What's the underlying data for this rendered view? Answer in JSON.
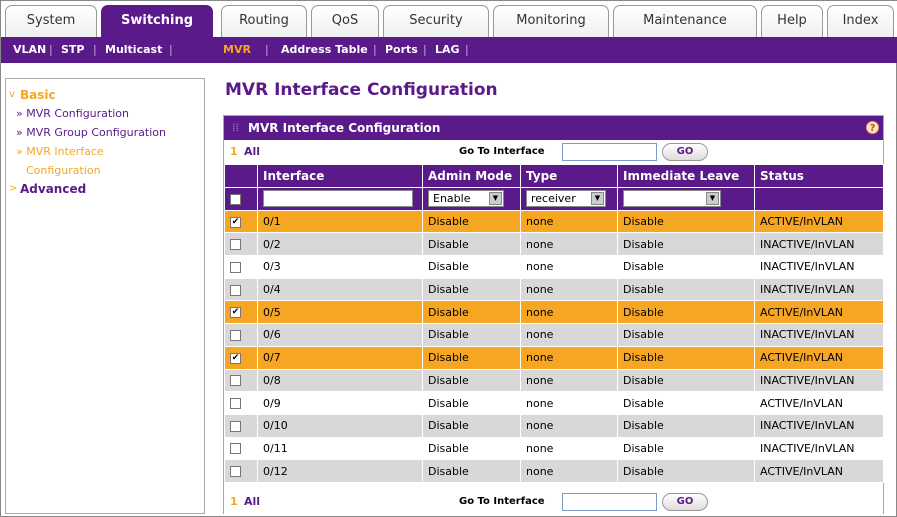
{
  "top_tabs": [
    "System",
    "Switching",
    "Routing",
    "QoS",
    "Security",
    "Monitoring",
    "Maintenance",
    "Help",
    "Index"
  ],
  "active_top_tab": "Switching",
  "subnav": [
    "VLAN",
    "STP",
    "Multicast",
    "MVR",
    "Address Table",
    "Ports",
    "LAG"
  ],
  "active_subnav": "MVR",
  "sidebar": {
    "basic": "Basic",
    "links": [
      "» MVR Configuration",
      "» MVR Group Configuration",
      "» MVR Interface",
      "Configuration"
    ],
    "advanced": "Advanced"
  },
  "page_title": "MVR Interface Configuration",
  "panel_title": "MVR Interface Configuration",
  "help_icon": "?",
  "bar": {
    "page": "1",
    "all": "All",
    "goto_label": "Go To Interface",
    "go_label": "GO"
  },
  "columns": [
    "",
    "Interface",
    "Admin Mode",
    "Type",
    "Immediate Leave",
    "Status"
  ],
  "filter": {
    "admin_mode": "Enable",
    "type": "receiver",
    "immediate_leave": ""
  },
  "rows": [
    {
      "checked": true,
      "interface": "0/1",
      "admin": "Disable",
      "type": "none",
      "leave": "Disable",
      "status": "ACTIVE/InVLAN"
    },
    {
      "checked": false,
      "interface": "0/2",
      "admin": "Disable",
      "type": "none",
      "leave": "Disable",
      "status": "INACTIVE/InVLAN"
    },
    {
      "checked": false,
      "interface": "0/3",
      "admin": "Disable",
      "type": "none",
      "leave": "Disable",
      "status": "INACTIVE/InVLAN"
    },
    {
      "checked": false,
      "interface": "0/4",
      "admin": "Disable",
      "type": "none",
      "leave": "Disable",
      "status": "INACTIVE/InVLAN"
    },
    {
      "checked": true,
      "interface": "0/5",
      "admin": "Disable",
      "type": "none",
      "leave": "Disable",
      "status": "ACTIVE/InVLAN"
    },
    {
      "checked": false,
      "interface": "0/6",
      "admin": "Disable",
      "type": "none",
      "leave": "Disable",
      "status": "INACTIVE/InVLAN"
    },
    {
      "checked": true,
      "interface": "0/7",
      "admin": "Disable",
      "type": "none",
      "leave": "Disable",
      "status": "ACTIVE/InVLAN"
    },
    {
      "checked": false,
      "interface": "0/8",
      "admin": "Disable",
      "type": "none",
      "leave": "Disable",
      "status": "INACTIVE/InVLAN"
    },
    {
      "checked": false,
      "interface": "0/9",
      "admin": "Disable",
      "type": "none",
      "leave": "Disable",
      "status": "ACTIVE/InVLAN"
    },
    {
      "checked": false,
      "interface": "0/10",
      "admin": "Disable",
      "type": "none",
      "leave": "Disable",
      "status": "INACTIVE/InVLAN"
    },
    {
      "checked": false,
      "interface": "0/11",
      "admin": "Disable",
      "type": "none",
      "leave": "Disable",
      "status": "INACTIVE/InVLAN"
    },
    {
      "checked": false,
      "interface": "0/12",
      "admin": "Disable",
      "type": "none",
      "leave": "Disable",
      "status": "ACTIVE/InVLAN"
    }
  ],
  "colors": {
    "brand": "#5a1a8a",
    "accent": "#f6a623"
  }
}
